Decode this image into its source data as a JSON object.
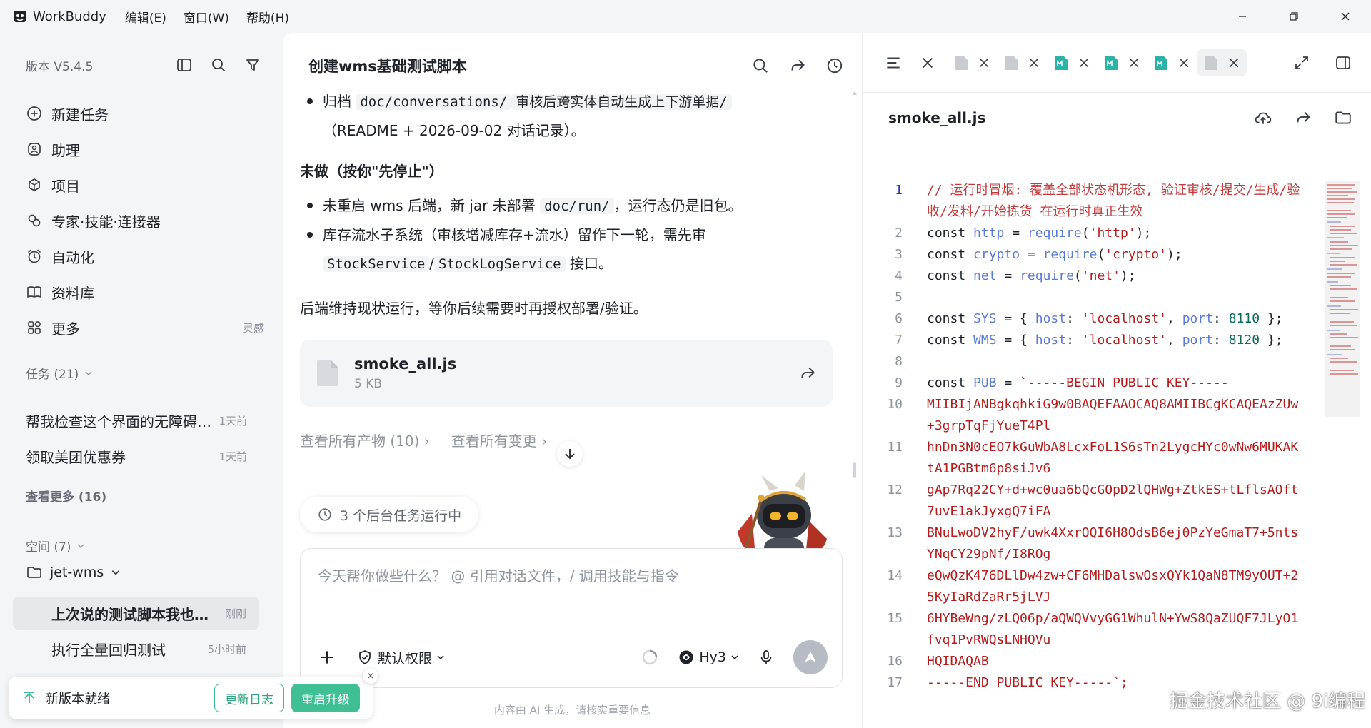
{
  "app": {
    "name": "WorkBuddy",
    "menu": [
      "编辑(E)",
      "窗口(W)",
      "帮助(H)"
    ]
  },
  "sidebar": {
    "version": "版本 V5.4.5",
    "nav": [
      {
        "label": "新建任务",
        "icon": "plus-circle-icon"
      },
      {
        "label": "助理",
        "icon": "assistant-icon"
      },
      {
        "label": "项目",
        "icon": "project-icon"
      },
      {
        "label": "专家·技能·连接器",
        "icon": "expert-icon"
      },
      {
        "label": "自动化",
        "icon": "alarm-clock-icon"
      },
      {
        "label": "资料库",
        "icon": "book-icon"
      },
      {
        "label": "更多",
        "icon": "grid-icon",
        "extra": "灵感"
      }
    ],
    "tasks_header": "任务 (21)",
    "tasks": [
      {
        "title": "帮我检查这个界面的无障碍问题",
        "time": "1天前"
      },
      {
        "title": "领取美团优惠券",
        "time": "1天前"
      }
    ],
    "see_more": "查看更多 (16)",
    "spaces_header": "空间 (7)",
    "space_folder": "jet-wms",
    "space_tasks": [
      {
        "title": "上次说的测试脚本我也要一下",
        "time": "刚刚",
        "active": true
      },
      {
        "title": "执行全量回归测试",
        "time": "5小时前",
        "active": false
      }
    ]
  },
  "toast": {
    "text": "新版本就绪",
    "changelog": "更新日志",
    "restart": "重启升级",
    "close": "×"
  },
  "chat": {
    "title": "创建wms基础测试脚本",
    "archive_prefix": "归档",
    "archive_path": "doc/conversations/",
    "archive_rest": "审核后跨实体自动生成上下游单据/",
    "archive_line2": "（README + 2026-09-02 对话记录）。",
    "undone_heading": "未做（按你\"先停止\"）",
    "undone1_a": "未重启 wms 后端，新 jar 未部署",
    "undone1_code": "doc/run/",
    "undone1_b": "，运行态仍是旧包。",
    "undone2_a": "库存流水子系统（审核增减库存+流水）留作下一轮，需先审",
    "undone2_code1": "StockService",
    "undone2_sep": "/",
    "undone2_code2": "StockLogService",
    "undone2_b": "接口。",
    "closing": "后端维持现状运行，等你后续需要时再授权部署/验证。",
    "file": {
      "name": "smoke_all.js",
      "size": "5 KB"
    },
    "links": [
      "查看所有产物 (10)",
      "查看所有变更"
    ],
    "bg_tasks": "3 个后台任务运行中",
    "placeholder": "今天帮你做些什么？ @ 引用对话文件，/ 调用技能与指令",
    "permission": "默认权限",
    "model": "Hy3",
    "disclaimer": "内容由 AI 生成，请核实重要信息"
  },
  "preview": {
    "file_title": "smoke_all.js",
    "code": [
      {
        "n": "1",
        "parts": [
          [
            "c",
            "// 运行时冒烟: 覆盖全部状态机形态, 验证审核/提交/生成/验收/发料/开始拣货 在运行时真正生效"
          ]
        ]
      },
      {
        "n": "2",
        "parts": [
          [
            "k",
            "const "
          ],
          [
            "v",
            "http"
          ],
          [
            "k",
            " = "
          ],
          [
            "v",
            "require"
          ],
          [
            "k",
            "("
          ],
          [
            "s",
            "'http'"
          ],
          [
            "k",
            ");"
          ]
        ]
      },
      {
        "n": "3",
        "parts": [
          [
            "k",
            "const "
          ],
          [
            "v",
            "crypto"
          ],
          [
            "k",
            " = "
          ],
          [
            "v",
            "require"
          ],
          [
            "k",
            "("
          ],
          [
            "s",
            "'crypto'"
          ],
          [
            "k",
            ");"
          ]
        ]
      },
      {
        "n": "4",
        "parts": [
          [
            "k",
            "const "
          ],
          [
            "v",
            "net"
          ],
          [
            "k",
            " = "
          ],
          [
            "v",
            "require"
          ],
          [
            "k",
            "("
          ],
          [
            "s",
            "'net'"
          ],
          [
            "k",
            ");"
          ]
        ]
      },
      {
        "n": "5",
        "parts": [
          [
            "k",
            ""
          ]
        ]
      },
      {
        "n": "6",
        "parts": [
          [
            "k",
            "const "
          ],
          [
            "v",
            "SYS"
          ],
          [
            "k",
            " = { "
          ],
          [
            "v",
            "host"
          ],
          [
            "k",
            ": "
          ],
          [
            "s",
            "'localhost'"
          ],
          [
            "k",
            ", "
          ],
          [
            "v",
            "port"
          ],
          [
            "k",
            ": "
          ],
          [
            "n",
            "8110"
          ],
          [
            "k",
            " };"
          ]
        ]
      },
      {
        "n": "7",
        "parts": [
          [
            "k",
            "const "
          ],
          [
            "v",
            "WMS"
          ],
          [
            "k",
            " = { "
          ],
          [
            "v",
            "host"
          ],
          [
            "k",
            ": "
          ],
          [
            "s",
            "'localhost'"
          ],
          [
            "k",
            ", "
          ],
          [
            "v",
            "port"
          ],
          [
            "k",
            ": "
          ],
          [
            "n",
            "8120"
          ],
          [
            "k",
            " };"
          ]
        ]
      },
      {
        "n": "8",
        "parts": [
          [
            "k",
            ""
          ]
        ]
      },
      {
        "n": "9",
        "parts": [
          [
            "k",
            "const "
          ],
          [
            "v",
            "PUB"
          ],
          [
            "k",
            " = "
          ],
          [
            "s",
            "`-----BEGIN PUBLIC KEY-----"
          ]
        ]
      },
      {
        "n": "10",
        "parts": [
          [
            "s",
            "MIIBIjANBgkqhkiG9w0BAQEFAAOCAQ8AMIIBCgKCAQEAzZUw+3grpTqFjYueT4Pl"
          ]
        ]
      },
      {
        "n": "11",
        "parts": [
          [
            "s",
            "hnDn3N0cEO7kGuWbA8LcxFoL1S6sTn2LygcHYc0wNw6MUKAKtA1PGBtm6p8siJv6"
          ]
        ]
      },
      {
        "n": "12",
        "parts": [
          [
            "s",
            "gAp7Rq22CY+d+wc0ua6bQcGOpD2lQHWg+ZtkES+tLflsAOft7uvE1akJyxgQ7iFA"
          ]
        ]
      },
      {
        "n": "13",
        "parts": [
          [
            "s",
            "BNuLwoDV2hyF/uwk4XxrOQI6H8OdsB6ej0PzYeGmaT7+5ntsYNqCY29pNf/I8ROg"
          ]
        ]
      },
      {
        "n": "14",
        "parts": [
          [
            "s",
            "eQwQzK476DLlDw4zw+CF6MHDalswOsxQYk1QaN8TM9yOUT+25KyIaRdZaRr5jLVJ"
          ]
        ]
      },
      {
        "n": "15",
        "parts": [
          [
            "s",
            "6HYBeWng/zLQ06p/aQWQVvyGG1WhulN+YwS8QaZUQF7JLyO1fvq1PvRWQsLNHQVu"
          ]
        ]
      },
      {
        "n": "16",
        "parts": [
          [
            "s",
            "HQIDAQAB"
          ]
        ]
      },
      {
        "n": "17",
        "parts": [
          [
            "s",
            "-----END PUBLIC KEY-----`;"
          ]
        ]
      }
    ]
  },
  "watermark": "掘金技术社区 @ 9i编程",
  "colors": {
    "accent_green": "#3fbf94",
    "code_string": "#b31d1d",
    "code_comment": "#c23b3b"
  }
}
